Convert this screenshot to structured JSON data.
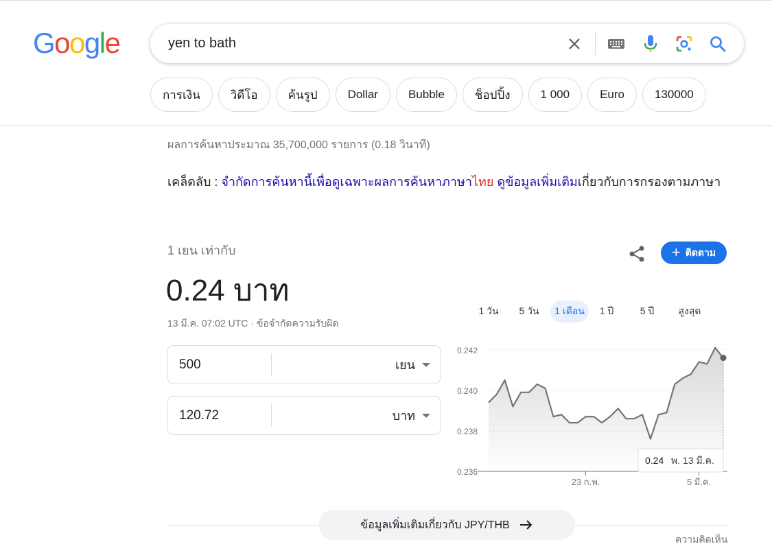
{
  "logo": {
    "letters": [
      {
        "ch": "G",
        "color": "#4285F4"
      },
      {
        "ch": "o",
        "color": "#EA4335"
      },
      {
        "ch": "o",
        "color": "#FBBC05"
      },
      {
        "ch": "g",
        "color": "#4285F4"
      },
      {
        "ch": "l",
        "color": "#34A853"
      },
      {
        "ch": "e",
        "color": "#EA4335"
      }
    ]
  },
  "search": {
    "query": "yen to bath",
    "icons": [
      "close-icon",
      "keyboard-icon",
      "microphone-icon",
      "google-lens-icon",
      "search-icon"
    ]
  },
  "chips": [
    "การเงิน",
    "วิดีโอ",
    "ค้นรูป",
    "Dollar",
    "Bubble",
    "ช็อปปิ้ง",
    "1 000",
    "Euro",
    "130000"
  ],
  "stats": "ผลการค้นหาประมาณ 35,700,000 รายการ (0.18 วินาที)",
  "tip": {
    "prefix": "เคล็ดลับ : ",
    "link_text": "จำกัดการค้นหานี้เพื่อดูเฉพาะผลการค้นหาภาษา",
    "language": "ไทย",
    "learn_more": "ดูข้อมูลเพิ่มเติม",
    "suffix": "เกี่ยวกับการกรองตามภาษา"
  },
  "converter": {
    "equals_label": "1 เยน เท่ากับ",
    "result": "0.24 บาท",
    "timestamp": "13 มี.ค. 07:02 UTC · ",
    "disclaimer": "ข้อจำกัดความรับผิด",
    "follow_label": "ติดตาม",
    "from": {
      "amount": "500",
      "currency": "เยน"
    },
    "to": {
      "amount": "120.72",
      "currency": "บาท"
    },
    "range_tabs": [
      "1 วัน",
      "5 วัน",
      "1 เดือน",
      "1 ปี",
      "5 ปี",
      "สูงสุด"
    ],
    "active_range": 2,
    "more_info": "ข้อมูลเพิ่มเติมเกี่ยวกับ JPY/THB",
    "feedback": "ความคิดเห็น"
  },
  "colors": {
    "accent": "#1a73e8",
    "line": "#70757a",
    "link": "#1a0dab",
    "red": "#d93025"
  },
  "chart_data": {
    "type": "line",
    "ylim": [
      0.236,
      0.2425
    ],
    "yticks": [
      "0.242",
      "0.240",
      "0.238",
      "0.236"
    ],
    "ytick_values": [
      0.242,
      0.24,
      0.238,
      0.236
    ],
    "xticks": [
      {
        "label": "23 ก.พ.",
        "index": 12
      },
      {
        "label": "5 มี.ค.",
        "index": 26
      }
    ],
    "values": [
      0.2394,
      0.2398,
      0.2405,
      0.2392,
      0.2399,
      0.2399,
      0.2403,
      0.2401,
      0.2387,
      0.2388,
      0.2384,
      0.2384,
      0.2387,
      0.2387,
      0.2384,
      0.2387,
      0.2391,
      0.2386,
      0.2386,
      0.2388,
      0.2376,
      0.2388,
      0.2389,
      0.2403,
      0.2406,
      0.2408,
      0.2414,
      0.2413,
      0.2421,
      0.2416
    ],
    "tooltip": {
      "value": "0.24",
      "date": "พ. 13 มี.ค."
    }
  }
}
